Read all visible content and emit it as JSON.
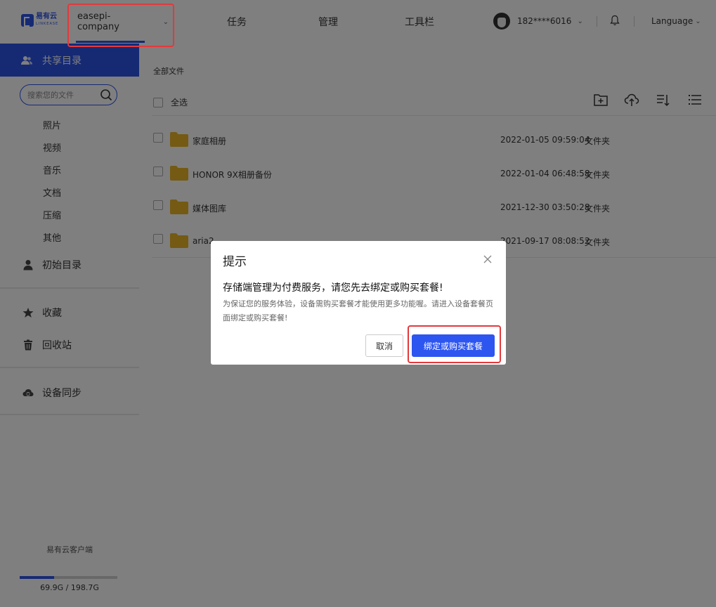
{
  "header": {
    "logo_text": "易有云",
    "logo_sub": "LINKEASE",
    "device": "easepi-company",
    "nav": [
      "任务",
      "管理",
      "工具栏"
    ],
    "user": "182****6016",
    "language": "Language"
  },
  "sidebar": {
    "active_item": "共享目录",
    "search_placeholder": "搜索您的文件",
    "categories": [
      "照片",
      "视频",
      "音乐",
      "文档",
      "压缩",
      "其他"
    ],
    "initial_dir": "初始目录",
    "favorites": "收藏",
    "trash": "回收站",
    "sync": "设备同步",
    "client": "易有云客户端",
    "storage_text": "69.9G / 198.7G",
    "storage_fraction": 0.352
  },
  "main": {
    "breadcrumb": "全部文件",
    "select_all": "全选",
    "files": [
      {
        "name": "家庭相册",
        "date": "2022-01-05 09:59:04",
        "type": "文件夹"
      },
      {
        "name": "HONOR 9X相册备份",
        "date": "2022-01-04 06:48:58",
        "type": "文件夹"
      },
      {
        "name": "媒体图库",
        "date": "2021-12-30 03:50:28",
        "type": "文件夹"
      },
      {
        "name": "aria2",
        "date": "2021-09-17 08:08:52",
        "type": "文件夹"
      }
    ]
  },
  "dialog": {
    "title": "提示",
    "message": "存储端管理为付费服务，请您先去绑定或购买套餐!",
    "description": "为保证您的服务体验，设备需购买套餐才能使用更多功能喔。请进入设备套餐页面绑定或购买套餐!",
    "cancel": "取消",
    "confirm": "绑定或购买套餐"
  },
  "colors": {
    "accent": "#2d55e8",
    "highlight_box": "#e4393c",
    "folder": "#e8b526"
  }
}
